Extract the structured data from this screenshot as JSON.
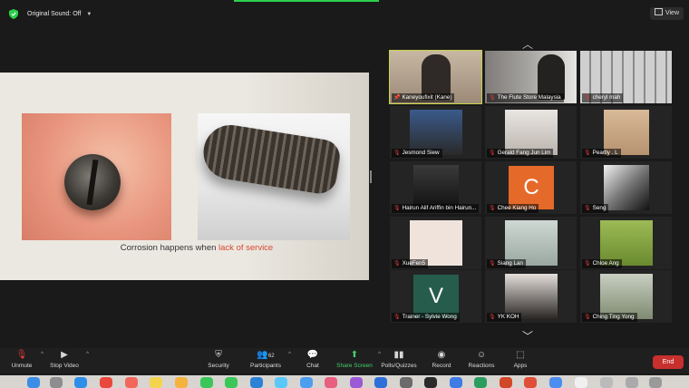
{
  "top": {
    "original_sound": "Original Sound: Off",
    "view": "View"
  },
  "slide": {
    "caption_main": "Corrosion happens when ",
    "caption_highlight": "lack of service"
  },
  "participants": [
    {
      "name": "Kaneyoufixit (Kane)",
      "active": true
    },
    {
      "name": "The Flute Store Malaysia"
    },
    {
      "name": "cheryl mah"
    },
    {
      "name": "Jesmond Siew"
    },
    {
      "name": "Gerald Fang Jun Lim"
    },
    {
      "name": "Pearlly . L"
    },
    {
      "name": "Hairun Alif Ariffin bin Hairun..."
    },
    {
      "name": "Chee Kiang Ho",
      "initial": "C"
    },
    {
      "name": "Seng"
    },
    {
      "name": "XueFen5"
    },
    {
      "name": "Siang Lan"
    },
    {
      "name": "Chloe Ang"
    },
    {
      "name": "Trainer - Sylvie Wong",
      "initial": "V"
    },
    {
      "name": "YK KOH"
    },
    {
      "name": "Ching Ting Yong"
    }
  ],
  "toolbar": {
    "unmute": "Unmute",
    "stop_video": "Stop Video",
    "security": "Security",
    "participants": "Participants",
    "participants_count": "62",
    "chat": "Chat",
    "share_screen": "Share Screen",
    "polls": "Polls/Quizzes",
    "record": "Record",
    "reactions": "Reactions",
    "apps": "Apps",
    "end": "End"
  },
  "colors": {
    "accent_green": "#46d06a",
    "end_red": "#c7302c",
    "active_outline": "#c9d24a",
    "highlight_text": "#d8472f"
  }
}
